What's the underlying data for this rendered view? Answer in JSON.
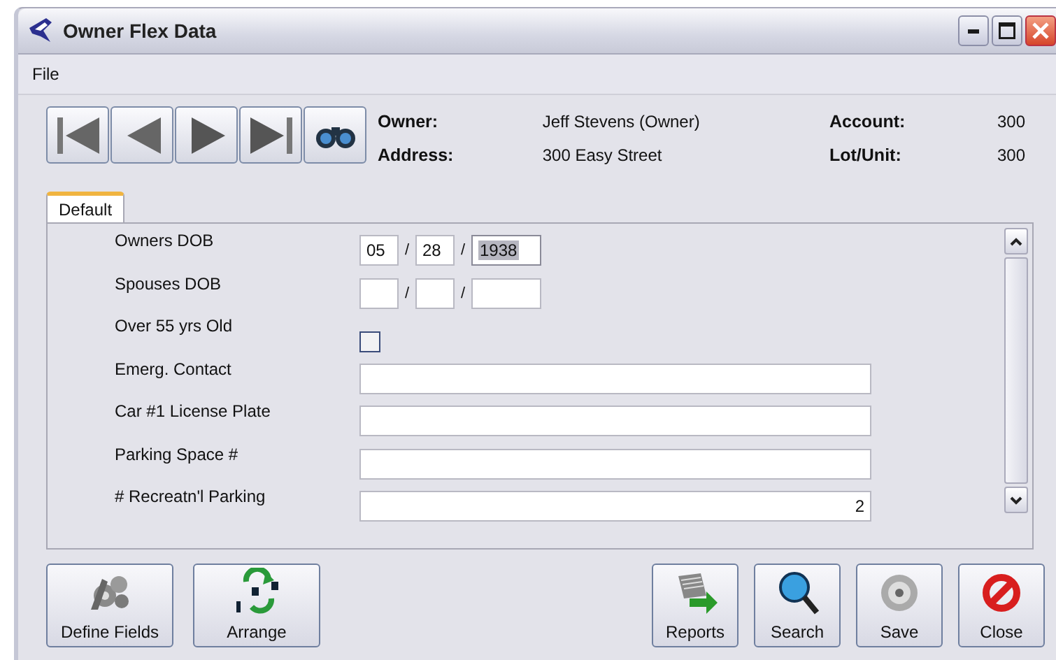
{
  "window": {
    "title": "Owner Flex Data"
  },
  "menu": [
    "File"
  ],
  "nav_buttons": [
    {
      "kind": "first"
    },
    {
      "kind": "prev"
    },
    {
      "kind": "next"
    },
    {
      "kind": "last"
    },
    {
      "kind": "find"
    }
  ],
  "header": [
    {
      "label": "Owner:",
      "value": "Jeff Stevens (Owner)"
    },
    {
      "label": "Address:",
      "value": "300 Easy Street"
    }
  ],
  "header_right": [
    {
      "label": "Account:",
      "value": "300"
    },
    {
      "label": "Lot/Unit:",
      "value": "300"
    }
  ],
  "tabs": [
    {
      "label": "Default",
      "selected": true
    }
  ],
  "fields": [
    {
      "kind": "date",
      "label": "Owners DOB",
      "separator": "/",
      "parts": [
        {
          "value": "05",
          "selected": false
        },
        {
          "value": "28",
          "selected": false
        },
        {
          "value": "1938",
          "selected": true
        }
      ]
    },
    {
      "kind": "date",
      "label": "Spouses DOB",
      "separator": "/",
      "parts": [
        {
          "selected": false
        },
        {
          "selected": false
        },
        {
          "selected": false
        }
      ]
    },
    {
      "kind": "checkbox",
      "label": "Over 55 yrs Old",
      "checked": false
    },
    {
      "kind": "text",
      "label": "Emerg. Contact"
    },
    {
      "kind": "text",
      "label": "Car #1 License Plate"
    },
    {
      "kind": "text",
      "label": "Parking Space #"
    },
    {
      "kind": "number",
      "label": "# Recreatn'l Parking",
      "value": "2"
    }
  ],
  "buttons_left": [
    {
      "kind": "define",
      "label": "Define Fields"
    },
    {
      "kind": "arrange",
      "label": "Arrange"
    }
  ],
  "buttons_right": [
    {
      "kind": "reports",
      "label": "Reports"
    },
    {
      "kind": "search",
      "label": "Search"
    },
    {
      "kind": "save",
      "label": "Save"
    },
    {
      "kind": "close",
      "label": "Close"
    }
  ]
}
